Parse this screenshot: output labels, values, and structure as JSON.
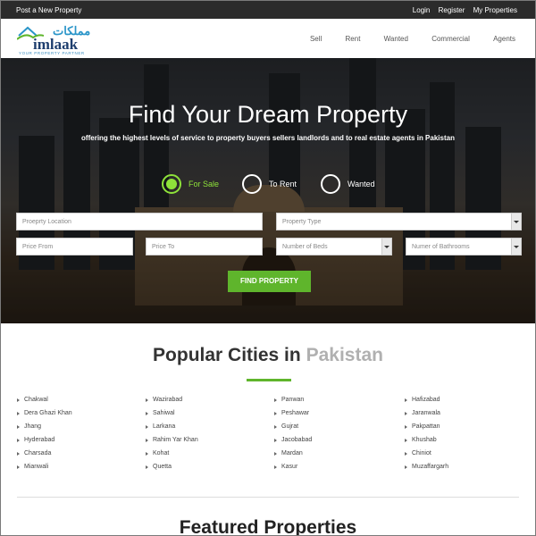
{
  "topbar": {
    "post": "Post a New Property",
    "login": "Login",
    "register": "Register",
    "my_properties": "My Properties"
  },
  "logo": {
    "urdu": "مملکات",
    "name": "imlaak",
    "tagline": "YOUR PROPERTY PARTNER"
  },
  "nav": [
    "Sell",
    "Rent",
    "Wanted",
    "Commercial",
    "Agents"
  ],
  "hero": {
    "title": "Find Your Dream Property",
    "subtitle": "offering the highest levels of service to property buyers sellers landlords and to real estate agents in Pakistan",
    "radios": [
      {
        "label": "For Sale",
        "selected": true
      },
      {
        "label": "To Rent",
        "selected": false
      },
      {
        "label": "Wanted",
        "selected": false
      }
    ],
    "fields": {
      "location": "Proeprty Location",
      "type": "Property Type",
      "price_from": "Price From",
      "price_to": "Price To",
      "beds": "Number of Beds",
      "baths": "Numer of Bathrooms"
    },
    "find_button": "FIND PROPERTY"
  },
  "cities": {
    "title": "Popular Cities in",
    "title_accent": "Pakistan",
    "columns": [
      [
        "Chakwal",
        "Dera Ghazi Khan",
        "Jhang",
        "Hyderabad",
        "Charsada",
        "Mianwali"
      ],
      [
        "Wazirabad",
        "Sahiwal",
        "Larkana",
        "Rahim Yar Khan",
        "Kohat",
        "Quetta"
      ],
      [
        "Panwan",
        "Peshawar",
        "Gujrat",
        "Jacobabad",
        "Mardan",
        "Kasur"
      ],
      [
        "Hafizabad",
        "Jaranwala",
        "Pakpattan",
        "Khushab",
        "Chiniot",
        "Muzaffargarh"
      ]
    ]
  },
  "featured": {
    "title": "Featured Properties"
  },
  "colors": {
    "accent_green": "#5fb52c",
    "radio_green": "#8ee23a",
    "topbar": "#2b2b2b",
    "logo_blue": "#1e3e6e"
  }
}
